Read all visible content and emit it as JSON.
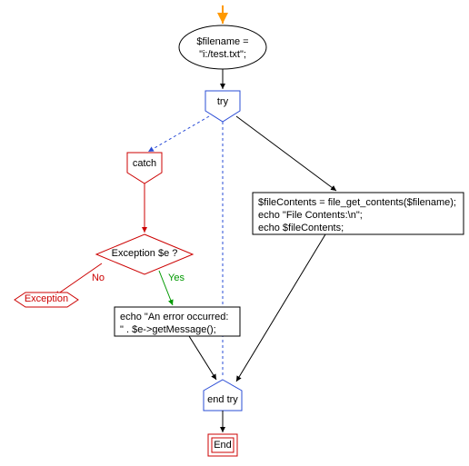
{
  "nodes": {
    "init": {
      "line1": "$filename =",
      "line2": "\"i:/test.txt\";"
    },
    "try_label": "try",
    "catch_label": "catch",
    "try_body": {
      "line1": "$fileContents = file_get_contents($filename);",
      "line2": "echo \"File Contents:\\n\";",
      "line3": "echo $fileContents;"
    },
    "decision": "Exception $e ?",
    "decision_no": "No",
    "decision_yes": "Yes",
    "exception_label": "Exception",
    "catch_body": {
      "line1": "echo \"An error occurred:",
      "line2": "\" . $e->getMessage();"
    },
    "end_try": "end try",
    "end": "End"
  }
}
